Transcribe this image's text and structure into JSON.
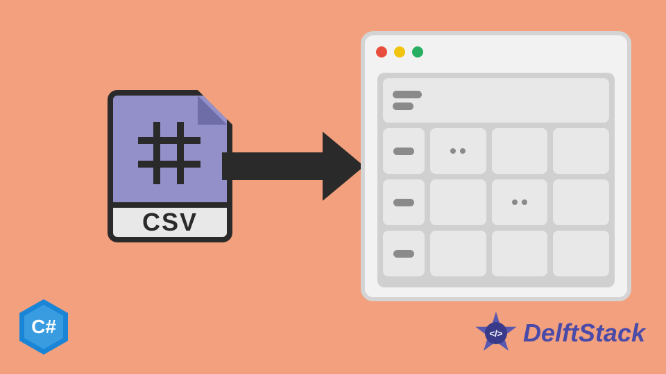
{
  "csv_file": {
    "label": "CSV"
  },
  "csharp_logo": {
    "text": "C#"
  },
  "delftstack": {
    "brand_text": "DelftStack",
    "logo_symbol": "</>"
  },
  "window": {
    "traffic_lights": [
      "red",
      "yellow",
      "green"
    ]
  }
}
